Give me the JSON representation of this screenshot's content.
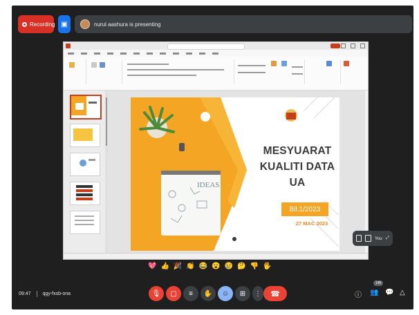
{
  "top_bar": {
    "recording_label": "Recording",
    "presenter_text": "nurul aashura is presenting"
  },
  "slide": {
    "title_line1": "MESYUARAT",
    "title_line2": "KUALITI DATA",
    "title_line3": "UA",
    "badge_text": "Bil.1/2023",
    "date_text": "27 MAC 2023"
  },
  "mini_control": {
    "label": "You"
  },
  "reactions": [
    "💖",
    "👍",
    "🎉",
    "👏",
    "😂",
    "😮",
    "😢",
    "🤔",
    "👎",
    "🖐"
  ],
  "bottom_bar": {
    "time": "09:47",
    "meeting_code": "qgy-fxsb-ona",
    "participants_badge": "146"
  },
  "colors": {
    "background": "#1f1f1f",
    "recording_red": "#d93025",
    "present_blue": "#1a73e8",
    "slide_accent": "#f5a524"
  }
}
